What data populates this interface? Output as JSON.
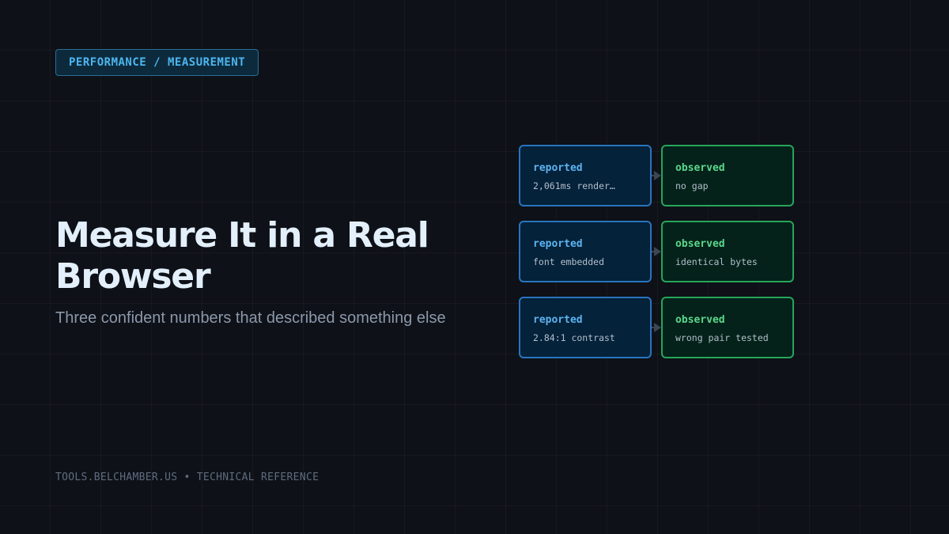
{
  "badge": {
    "text": "PERFORMANCE / MEASUREMENT"
  },
  "heading": {
    "title": "Measure It in a Real Browser",
    "subtitle": "Three confident numbers that described something else"
  },
  "comparisons": [
    {
      "reported_label": "reported",
      "reported_value": "2,061ms render…",
      "observed_label": "observed",
      "observed_value": "no gap"
    },
    {
      "reported_label": "reported",
      "reported_value": "font embedded",
      "observed_label": "observed",
      "observed_value": "identical bytes"
    },
    {
      "reported_label": "reported",
      "reported_value": "2.84:1 contrast",
      "observed_label": "observed",
      "observed_value": "wrong pair tested"
    }
  ],
  "footer": {
    "text": "TOOLS.BELCHAMBER.US • TECHNICAL REFERENCE"
  },
  "colors": {
    "background": "#0e1117",
    "accent_blue": "#4cb6ee",
    "reported_border": "#2874bf",
    "observed_border": "#27a55a",
    "title": "#e3f0fb"
  },
  "icons": {
    "connector": "arrow-right-icon"
  }
}
